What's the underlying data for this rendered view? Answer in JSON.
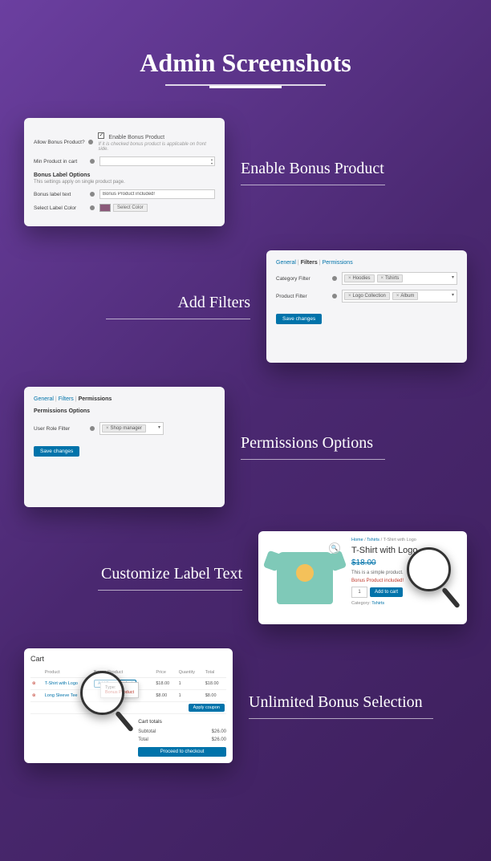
{
  "page_title": "Admin Screenshots",
  "sections": {
    "enable": {
      "caption": "Enable Bonus Product",
      "allow_label": "Allow Bonus Product?",
      "enable_checkbox": "Enable Bonus Product",
      "enable_hint": "If it is checked bonus product is applicable on front side.",
      "min_label": "Min Product in cart",
      "options_head": "Bonus Label Options",
      "options_sub": "This settings apply on single product page.",
      "label_text_label": "Bonus label text",
      "label_text_value": "Bonus Product included!",
      "color_label": "Select Label Color",
      "color_btn": "Select Color"
    },
    "filters": {
      "caption": "Add Filters",
      "tabs": {
        "general": "General",
        "filters": "Filters",
        "permissions": "Permissions"
      },
      "cat_label": "Category Filter",
      "cat_chips": [
        "Hoodies",
        "Tshirts"
      ],
      "prod_label": "Product Filter",
      "prod_chips": [
        "Logo Collection",
        "Album"
      ],
      "save": "Save changes"
    },
    "permissions": {
      "caption": "Permissions Options",
      "tabs": {
        "general": "General",
        "filters": "Filters",
        "permissions": "Permissions"
      },
      "head": "Permissions Options",
      "role_label": "User Role Filter",
      "role_chips": [
        "Shop manager"
      ],
      "save": "Save changes"
    },
    "customize": {
      "caption": "Customize Label Text",
      "breadcrumb": {
        "home": "Home",
        "cat": "Tshirts",
        "item": "T-Shirt with Logo"
      },
      "title": "T-Shirt with Logo",
      "price": "$18.00",
      "desc": "This is a simple product.",
      "bonus_label": "Bonus Product included!",
      "qty": "1",
      "cart_btn": "Add to cart",
      "category_label": "Category:",
      "category_value": "Tshirts",
      "zoom": "🔍"
    },
    "unlimited": {
      "caption": "Unlimited Bonus Selection",
      "cart_title": "Cart",
      "headers": {
        "product": "Product",
        "bonus": "Bonus Product",
        "price": "Price",
        "qty": "Quantity",
        "total": "Total"
      },
      "rows": [
        {
          "name": "T-Shirt with Logo",
          "bonus_btn": "Add Bonus Product",
          "price": "$18.00",
          "qty": "1",
          "total": "$18.00"
        },
        {
          "name": "Long Sleeve Tee",
          "bonus_btn": "",
          "price": "$8.00",
          "qty": "1",
          "total": "$8.00"
        }
      ],
      "apply": "Apply coupon",
      "tooltip": {
        "label": "Type:",
        "value": "Bonus Product"
      },
      "totals": {
        "title": "Cart totals",
        "subtotal_label": "Subtotal",
        "subtotal": "$26.00",
        "total_label": "Total",
        "total": "$26.00",
        "checkout": "Proceed to checkout"
      }
    }
  }
}
